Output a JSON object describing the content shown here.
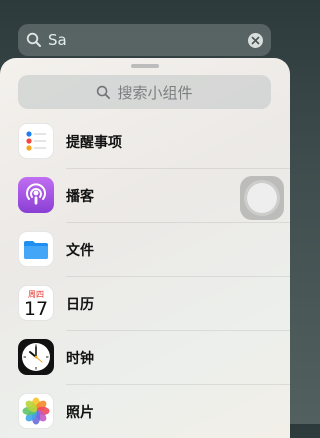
{
  "top_search": {
    "query": "Sa",
    "icon": "search-icon",
    "clear_icon": "clear-icon"
  },
  "widget_search": {
    "placeholder": "搜索小组件",
    "icon": "search-icon"
  },
  "apps": [
    {
      "label": "提醒事项",
      "icon": "reminders-icon"
    },
    {
      "label": "播客",
      "icon": "podcasts-icon"
    },
    {
      "label": "文件",
      "icon": "files-icon"
    },
    {
      "label": "日历",
      "icon": "calendar-icon",
      "weekday": "周四",
      "day": "17"
    },
    {
      "label": "时钟",
      "icon": "clock-icon"
    },
    {
      "label": "照片",
      "icon": "photos-icon"
    }
  ],
  "colors": {
    "podcasts": "#9b4fd8",
    "files": "#1e8ef0",
    "calendar_weekday": "#e0332b",
    "clock_hand": "#f5a623"
  }
}
